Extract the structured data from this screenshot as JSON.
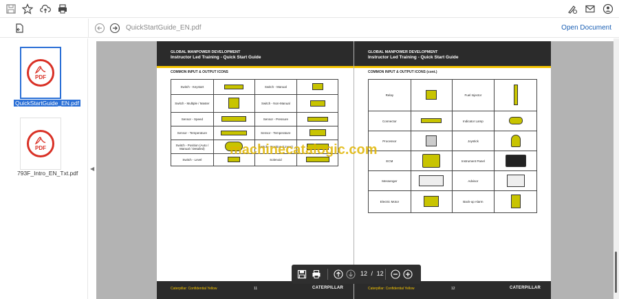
{
  "toolbar": {
    "left_icons": [
      "save-icon",
      "star-icon",
      "cloud-upload-icon",
      "print-icon"
    ],
    "right_icons": [
      "sign-icon",
      "mail-icon",
      "user-icon"
    ]
  },
  "nav": {
    "doc_title": "QuickStartGuide_EN.pdf",
    "open_document": "Open Document"
  },
  "files": [
    {
      "name": "QuickStartGuide_EN.pdf",
      "selected": true,
      "icon_text": "PDF"
    },
    {
      "name": "793F_Intro_EN_Txt.pdf",
      "selected": false,
      "icon_text": "PDF"
    }
  ],
  "pages": {
    "left": {
      "header1": "GLOBAL MANPOWER DEVELOPMENT",
      "header2": "Instructor Led Training - Quick Start Guide",
      "section": "COMMON INPUT & OUTPUT ICONS",
      "rows": [
        [
          "Switch - Keystart",
          "Switch - Manual"
        ],
        [
          "Switch - Multiple / Master",
          "Switch - Non-Manual"
        ],
        [
          "Sensor - Speed",
          "Sensor - Pressure"
        ],
        [
          "Sensor - Temperature",
          "Sensor - Temperature"
        ],
        [
          "Switch - Position (Auto / Manual / Detailed)",
          "Switch - Position (Linear)"
        ],
        [
          "Switch - Level",
          "Solenoid"
        ]
      ],
      "footer_conf": "Caterpillar: Confidential Yellow",
      "footer_num": "11",
      "footer_brand": "CATERPILLAR"
    },
    "right": {
      "header1": "GLOBAL MANPOWER DEVELOPMENT",
      "header2": "Instructor Led Training - Quick Start Guide",
      "section": "COMMON INPUT & OUTPUT ICONS (cont.)",
      "rows": [
        [
          "Relay",
          "Fuel Injector"
        ],
        [
          "Connector",
          "Indicator Lamp"
        ],
        [
          "Processor",
          "Joystick"
        ],
        [
          "ECM",
          "Instrument Panel"
        ],
        [
          "Messenger",
          "Advisor"
        ],
        [
          "Electric Motor",
          "Back-up Alarm"
        ]
      ],
      "footer_conf": "Caterpillar: Confidential Yellow",
      "footer_num": "12",
      "footer_brand": "CATERPILLAR"
    }
  },
  "watermark": "machinecatalogic.com",
  "controls": {
    "current_page": "12",
    "separator": "/",
    "total_pages": "12"
  },
  "colors": {
    "accent_blue": "#2a6fd6",
    "pdf_red": "#d93025",
    "cat_yellow": "#f5c400",
    "icon_yellow": "#c8c400",
    "viewer_gray": "#b3b3b3"
  }
}
